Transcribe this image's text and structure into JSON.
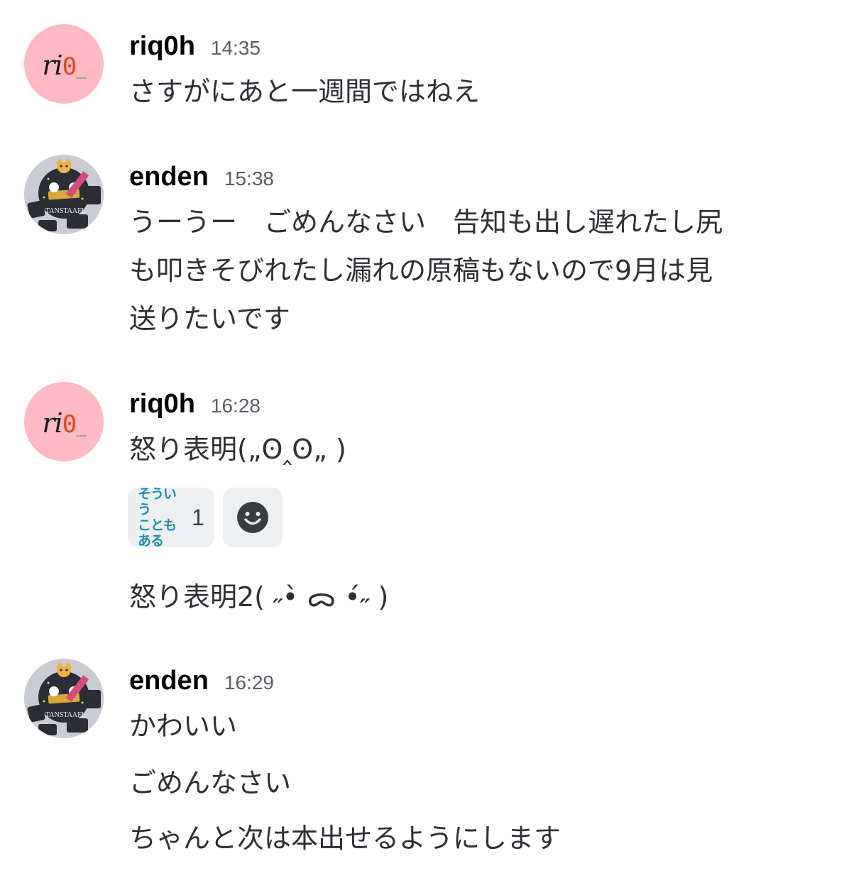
{
  "messages": [
    {
      "author": "riq0h",
      "avatar_text_main": "ri",
      "avatar_text_zero": "0",
      "avatar_text_under": "_",
      "time": "14:35",
      "lines": [
        "さすがにあと一週間ではねえ"
      ]
    },
    {
      "author": "enden",
      "avatar_caption": "TANSTAAFL",
      "time": "15:38",
      "lines": [
        "うーうー　ごめんなさい　告知も出し遅れたし尻",
        "も叩きそびれたし漏れの原稿もないので9月は見",
        "送りたいです"
      ]
    },
    {
      "author": "riq0h",
      "avatar_text_main": "ri",
      "avatar_text_zero": "0",
      "avatar_text_under": "_",
      "time": "16:28",
      "lines": [
        "怒り表明(„ʘ‸ʘ„ )",
        "怒り表明2( ˶•̀ ᯅ •́˶ )"
      ],
      "reactions": [
        {
          "emoji_text_line1": "そういう",
          "emoji_text_line2": "こともある",
          "count": "1"
        }
      ]
    },
    {
      "author": "enden",
      "avatar_caption": "TANSTAAFL",
      "time": "16:29",
      "lines": [
        "かわいい",
        "ごめんなさい",
        "ちゃんと次は本出せるようにします"
      ]
    }
  ],
  "colors": {
    "rio_avatar_bg": "#fdb9c4",
    "enden_avatar_bg": "#c9ccd2",
    "reaction_bg": "#eeeff1",
    "add_reaction_icon": "#3a3c42"
  },
  "icons": {
    "add_reaction": "smile-face-icon"
  }
}
